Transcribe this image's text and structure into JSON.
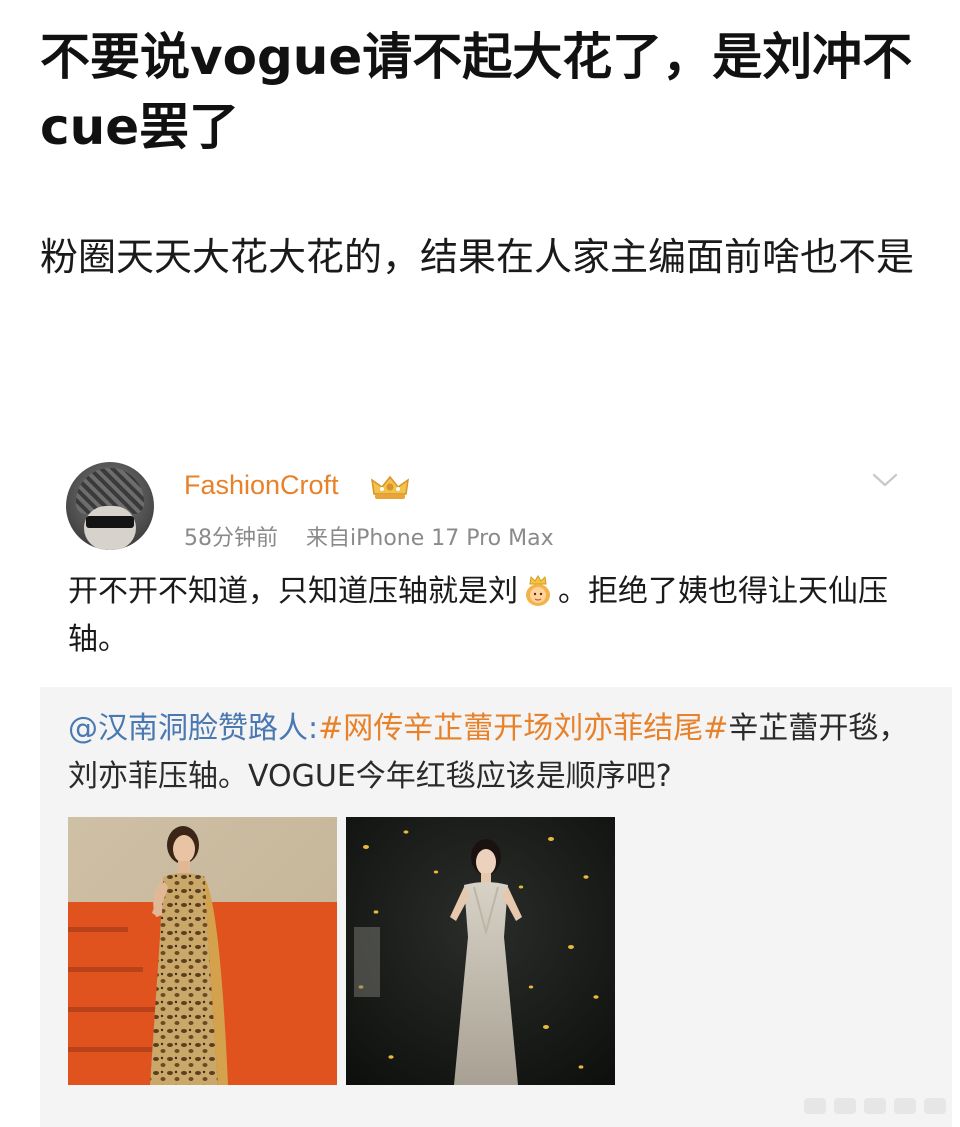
{
  "post": {
    "title": "不要说vogue请不起大花了，是刘冲不cue罢了",
    "body": "粉圈天天大花大花的，结果在人家主编面前啥也不是"
  },
  "embedded": {
    "username": "FashionCroft",
    "time": "58分钟前",
    "source": "来自iPhone 17 Pro Max",
    "text_before_emoji": "开不开不知道，只知道压轴就是刘",
    "emoji": "princess-emoji",
    "text_after_emoji": "。拒绝了姨也得让天仙压轴。",
    "quote": {
      "mention": "@汉南洞脸赞路人:",
      "hashtag": "#网传辛芷蕾开场刘亦菲结尾#",
      "text": "辛芷蕾开毯，刘亦菲压轴。VOGUE今年红毯应该是顺序吧?"
    },
    "images": [
      "red-carpet-photo-left",
      "red-carpet-photo-right"
    ]
  },
  "colors": {
    "username": "#e8822a",
    "hashtag": "#e8822a",
    "mention": "#4a78b2",
    "meta": "#8a8a8a",
    "quote_bg": "#f4f4f4"
  }
}
